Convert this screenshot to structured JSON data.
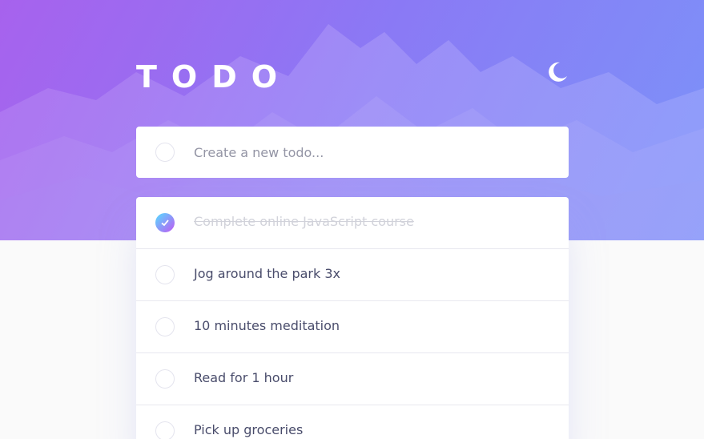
{
  "app": {
    "title": "TODO",
    "theme_toggle_icon": "moon-icon"
  },
  "new_todo": {
    "placeholder": "Create a new todo..."
  },
  "todos": [
    {
      "label": "Complete online JavaScript course",
      "completed": true
    },
    {
      "label": "Jog around the park 3x",
      "completed": false
    },
    {
      "label": "10 minutes meditation",
      "completed": false
    },
    {
      "label": "Read for 1 hour",
      "completed": false
    },
    {
      "label": "Pick up groceries",
      "completed": false
    }
  ],
  "colors": {
    "accent_start": "#55ddff",
    "accent_end": "#c058f3",
    "text": "#494c6b",
    "completed_text": "#d1d2da",
    "hero_start": "#a366f0",
    "hero_end": "#7f8ff7"
  }
}
